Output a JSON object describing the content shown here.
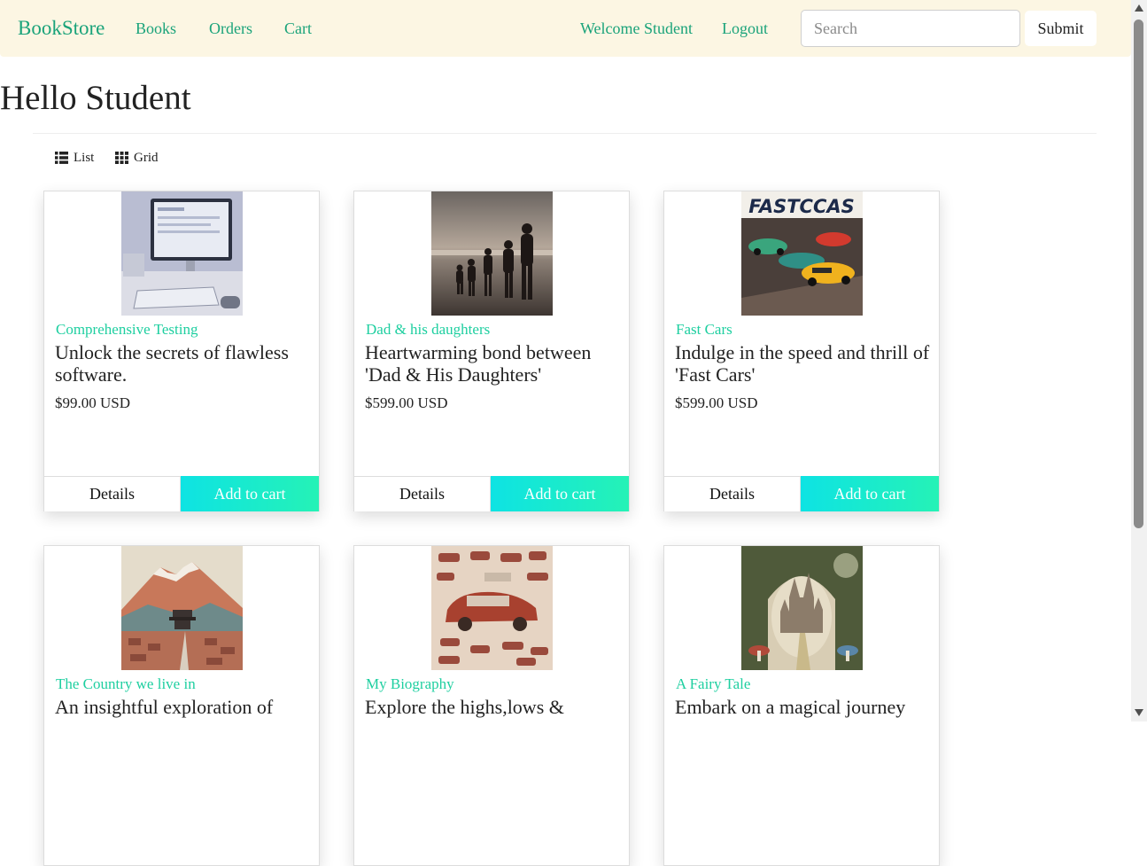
{
  "nav": {
    "brand": "BookStore",
    "links": [
      "Books",
      "Orders",
      "Cart"
    ],
    "welcome": "Welcome Student",
    "logout": "Logout",
    "search_placeholder": "Search",
    "search_value": "",
    "submit_label": "Submit"
  },
  "page": {
    "title": "Hello Student"
  },
  "view_toggle": {
    "list_label": "List",
    "list_icon": "list-icon",
    "grid_label": "Grid",
    "grid_icon": "grid-icon"
  },
  "cards": [
    {
      "category": "Comprehensive Testing",
      "description": "Unlock the secrets of flawless software.",
      "price": "$99.00 USD",
      "details_label": "Details",
      "cart_label": "Add to cart",
      "image": "computer-workstation-image"
    },
    {
      "category": "Dad & his daughters",
      "description": "Heartwarming bond between 'Dad & His Daughters'",
      "price": "$599.00 USD",
      "details_label": "Details",
      "cart_label": "Add to cart",
      "image": "family-silhouette-beach-image"
    },
    {
      "category": "Fast Cars",
      "description": "Indulge in the speed and thrill of 'Fast Cars'",
      "price": "$599.00 USD",
      "details_label": "Details",
      "cart_label": "Add to cart",
      "image": "fast-cars-racing-image",
      "image_text": "FASTCCAS"
    },
    {
      "category": "The Country we live in",
      "description": "An insightful exploration of",
      "image": "mountain-village-image"
    },
    {
      "category": "My Biography",
      "description": "Explore the highs,lows &",
      "image": "vintage-cars-collage-image"
    },
    {
      "category": "A Fairy Tale",
      "description": "Embark on a magical journey",
      "image": "fairy-castle-image"
    }
  ],
  "colors": {
    "navbar_bg": "#fcf6e3",
    "link": "#1aa37a",
    "category": "#1ecfa0",
    "cart_gradient_start": "#0ee3e3",
    "cart_gradient_end": "#25f2b6"
  }
}
